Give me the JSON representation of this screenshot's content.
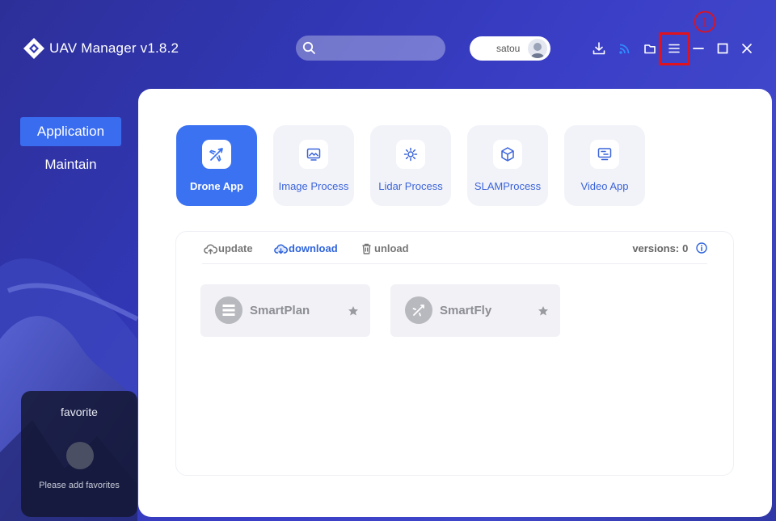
{
  "header": {
    "app_title": "UAV Manager v1.8.2",
    "search_placeholder": "",
    "username": "satou",
    "icons": [
      "download-icon",
      "wifi-icon",
      "folder-icon",
      "menu-icon",
      "minimize-icon",
      "maximize-icon",
      "close-icon"
    ],
    "annotation_marker": "①",
    "annotation_color": "#e0121d"
  },
  "sidebar": {
    "items": [
      {
        "label": "Application",
        "active": true
      },
      {
        "label": "Maintain",
        "active": false
      }
    ]
  },
  "favorites": {
    "title": "favorite",
    "hint": "Please add favorites"
  },
  "categories": [
    {
      "label": "Drone App",
      "icon": "plane-icon",
      "active": true
    },
    {
      "label": "Image Process",
      "icon": "image-icon",
      "active": false
    },
    {
      "label": "Lidar Process",
      "icon": "lidar-icon",
      "active": false
    },
    {
      "label": "SLAMProcess",
      "icon": "cube-icon",
      "active": false
    },
    {
      "label": "Video App",
      "icon": "video-icon",
      "active": false
    }
  ],
  "tabs": [
    {
      "label": "update",
      "icon": "cloud-update-icon",
      "active": false
    },
    {
      "label": "download",
      "icon": "cloud-download-icon",
      "active": true
    },
    {
      "label": "unload",
      "icon": "trash-icon",
      "active": false
    }
  ],
  "versions": {
    "label": "versions:",
    "value": "0"
  },
  "apps": [
    {
      "name": "SmartPlan",
      "icon": "list-icon"
    },
    {
      "name": "SmartFly",
      "icon": "drone-icon"
    }
  ],
  "colors": {
    "accent": "#3a72f2",
    "nav_active": "#3a6cf0",
    "tab_active": "#2f64dc",
    "highlight_box": "#e0121d"
  }
}
